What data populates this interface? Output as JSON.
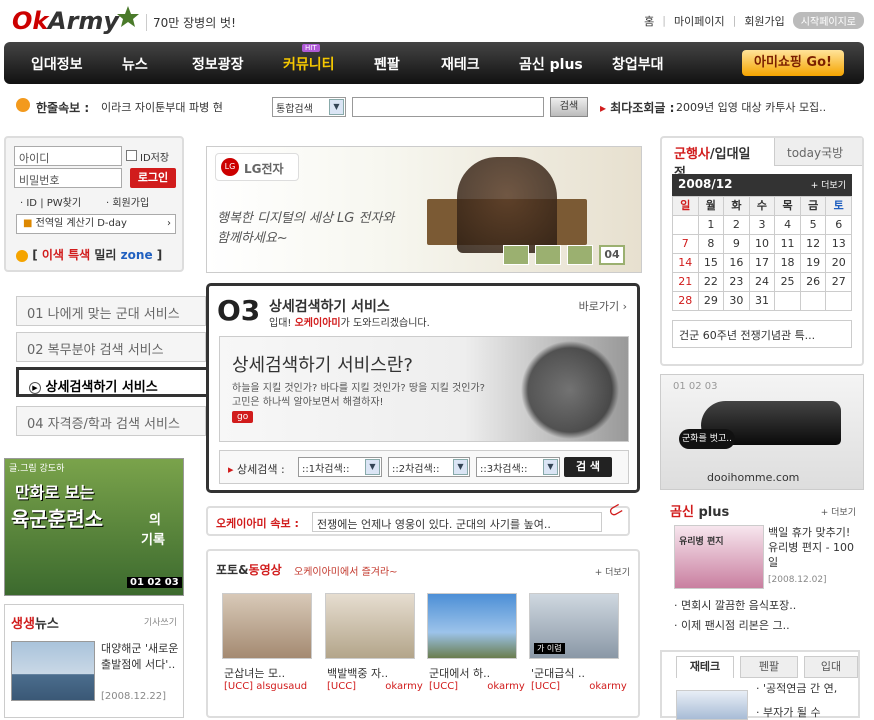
{
  "header": {
    "logo_text": "OkArmy",
    "slogan": "70만 장병의 벗!",
    "links": [
      "홈",
      "마이페이지",
      "회원가입"
    ],
    "start_page": "시작페이지로"
  },
  "nav": {
    "items": [
      "입대정보",
      "뉴스",
      "정보광장",
      "커뮤니티",
      "펜팔",
      "재테크",
      "곰신 plus",
      "창업부대"
    ],
    "hit_badge": "HIT",
    "shop_button": "아미쇼핑 Go!"
  },
  "flash": {
    "label": "한줄속보 :",
    "text": "이라크 자이툰부대 파병 현"
  },
  "search": {
    "scope": "통합검색",
    "button": "검색",
    "hot_label": "최다조회글 :",
    "hot_text": "2009년 입영 대상 카투사 모집.."
  },
  "login": {
    "id_placeholder": "아이디",
    "pw_placeholder": "비밀번호",
    "save_id": "ID저장",
    "login_button": "로그인",
    "find": "ID | PW찾기",
    "join": "회원가입",
    "dday": "전역일 계산기 D-day",
    "zone_bracket_open": "[",
    "zone_1": "이색 특색",
    "zone_2": "밀리",
    "zone_3": "zone",
    "zone_bracket_close": "]"
  },
  "left_menu": {
    "items": [
      "01 나에게 맞는 군대 서비스",
      "02 복무분야 검색 서비스",
      "상세검색하기 서비스",
      "04 자격증/학과 검색 서비스"
    ]
  },
  "banner": {
    "brand": "LG전자",
    "slogan_line1": "행복한 디지털의 세상 LG 전자와",
    "slogan_line2": "함께하세요~",
    "page": "04"
  },
  "detail": {
    "num": "O3",
    "title": "상세검색하기 서비스",
    "shortcut": "바로가기",
    "sub_a": "입대!",
    "sub_b": "오케이아미",
    "sub_c": "가 도와드리겠습니다.",
    "heading": "상세검색하기 서비스란?",
    "desc1": "하늘을 지킬 것인가? 바다를 지킬 것인가? 땅을 지킬 것인가?",
    "desc2": "고민은 하나씩 알아보면서 해결하자!",
    "go": "go",
    "search_label": "상세검색 :",
    "sel1": "::1차검색::",
    "sel2": "::2차검색::",
    "sel3": "::3차검색::",
    "search_button": "검 색"
  },
  "comic": {
    "tag": "글.그림 강도하",
    "line1": "만화로 보는",
    "line2": "육군훈련소",
    "line3": "의",
    "line4": "기록",
    "pages": "01 02 03"
  },
  "news": {
    "title_a": "생생",
    "title_b": "뉴스",
    "more": "기사쓰기",
    "headline": "대양해군 '새로운 출발점에 서다'..",
    "date": "[2008.12.22]"
  },
  "okflash": {
    "label": "오케이아미 속보 :",
    "text": "전쟁에는 언제나 영웅이 있다. 군대의 사기를 높여.."
  },
  "photo": {
    "title_a": "포토&",
    "title_b": "동영상",
    "subtitle": "오케이아미에서 즐겨라~",
    "more": "더보기",
    "items": [
      {
        "title": "군삽녀는 모..",
        "tag": "[UCC]",
        "user": "alsgusaud"
      },
      {
        "title": "백발백중 자..",
        "tag": "[UCC]",
        "user": "okarmy"
      },
      {
        "title": "군대에서 하..",
        "tag": "[UCC]",
        "user": "okarmy"
      },
      {
        "title": "'군대급식 ..",
        "tag": "[UCC]",
        "user": "okarmy"
      }
    ],
    "thumb4_caption": "가 이렴"
  },
  "right_tabs": {
    "tab1_a": "군행사",
    "tab1_b": "/입대일정",
    "tab2": "today국방",
    "month": "2008/12",
    "more": "더보기",
    "days": [
      "일",
      "월",
      "화",
      "수",
      "목",
      "금",
      "토"
    ],
    "weeks": [
      [
        "",
        "1",
        "2",
        "3",
        "4",
        "5",
        "6"
      ],
      [
        "7",
        "8",
        "9",
        "10",
        "11",
        "12",
        "13"
      ],
      [
        "14",
        "15",
        "16",
        "17",
        "18",
        "19",
        "20"
      ],
      [
        "21",
        "22",
        "23",
        "24",
        "25",
        "26",
        "27"
      ],
      [
        "28",
        "29",
        "30",
        "31",
        "",
        "",
        ""
      ]
    ],
    "event": "건군 60주년 전쟁기념관 특..."
  },
  "right_banner": {
    "pages": "01 02 03",
    "text": "군화를 벗고..",
    "url": "dooihomme.com"
  },
  "gongsin": {
    "title_a": "곰신",
    "title_b": "plus",
    "more": "더보기",
    "thumb_text": "유리병 편지",
    "headline": "백일 휴가 맞추기! 유리병 편지 - 100일",
    "date": "[2008.12.02]",
    "item1": "면회시 깔끔한 음식포장..",
    "item2": "이제 팬시점 리본은 그.."
  },
  "bottom_tabs": {
    "tabs": [
      "재테크",
      "펜팔",
      "입대"
    ],
    "item1": "'공적연금 간 연,",
    "item2": "부자가 될 수"
  }
}
